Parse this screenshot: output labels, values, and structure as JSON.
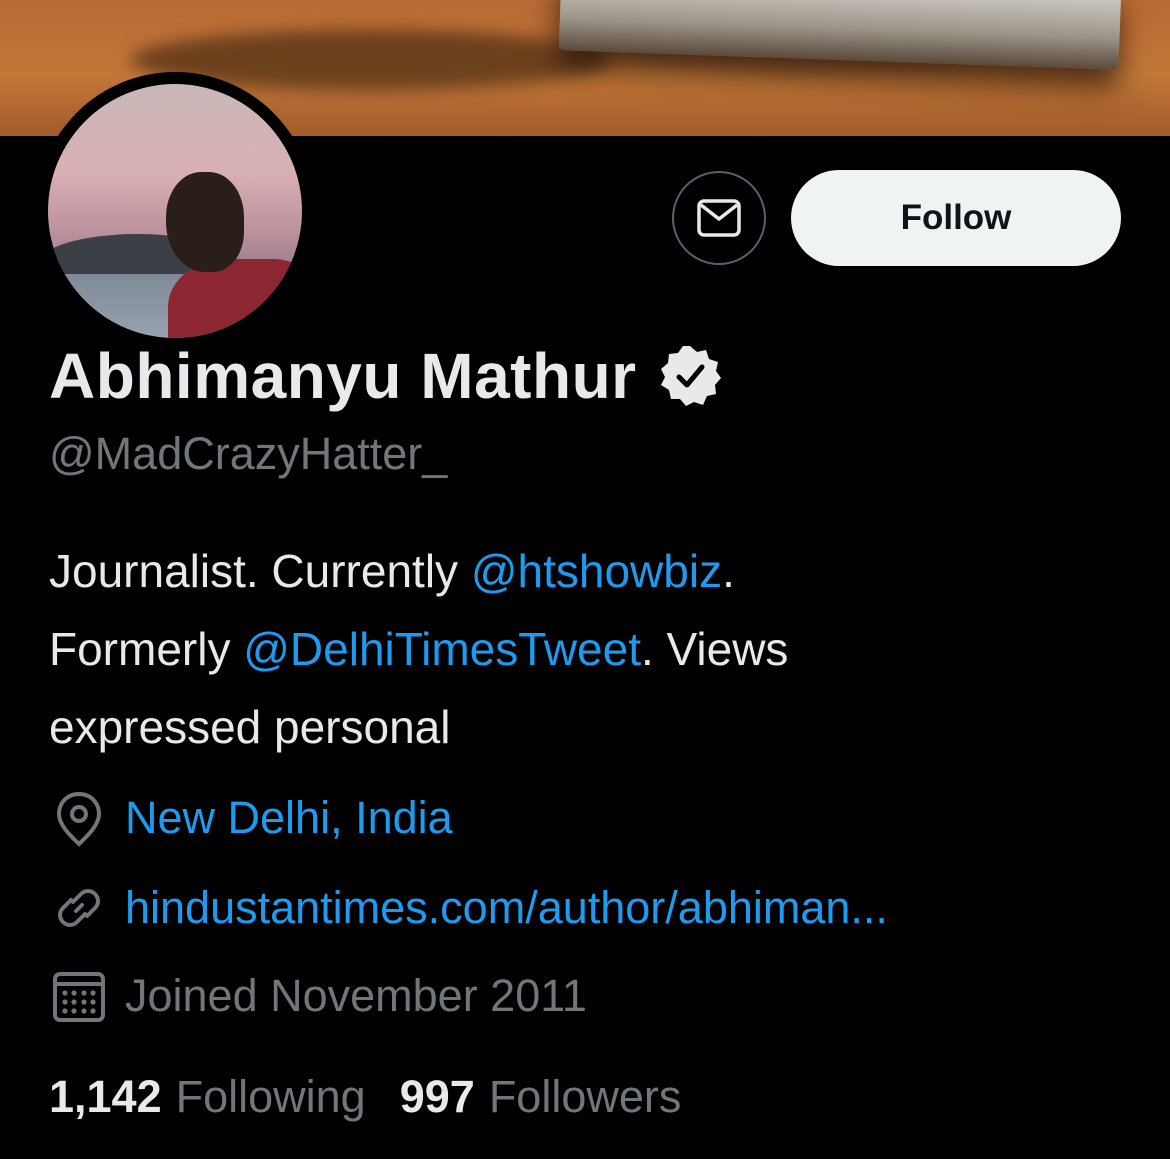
{
  "profile": {
    "name": "Abhimanyu Mathur",
    "handle": "@MadCrazyHatter_",
    "bio": {
      "part1": "Journalist. Currently ",
      "mention1": "@htshowbiz",
      "part2": ".",
      "part3": "Formerly ",
      "mention2": "@DelhiTimesTweet",
      "part4": ". Views",
      "part5": "expressed personal"
    },
    "location": "New Delhi, India",
    "website": "hindustantimes.com/author/abhiman...",
    "joined": "Joined November 2011",
    "following_count": "1,142",
    "following_label": "Following",
    "followers_count": "997",
    "followers_label": "Followers"
  },
  "actions": {
    "follow_label": "Follow"
  },
  "icons": {
    "message": "envelope-icon",
    "verified": "verified-badge-icon",
    "location": "location-pin-icon",
    "link": "link-icon",
    "calendar": "calendar-icon"
  },
  "colors": {
    "background": "#000000",
    "link": "#1d9bf0",
    "secondary_text": "#71767b",
    "primary_text": "#e7e9ea",
    "follow_button": "#eff3f4"
  }
}
